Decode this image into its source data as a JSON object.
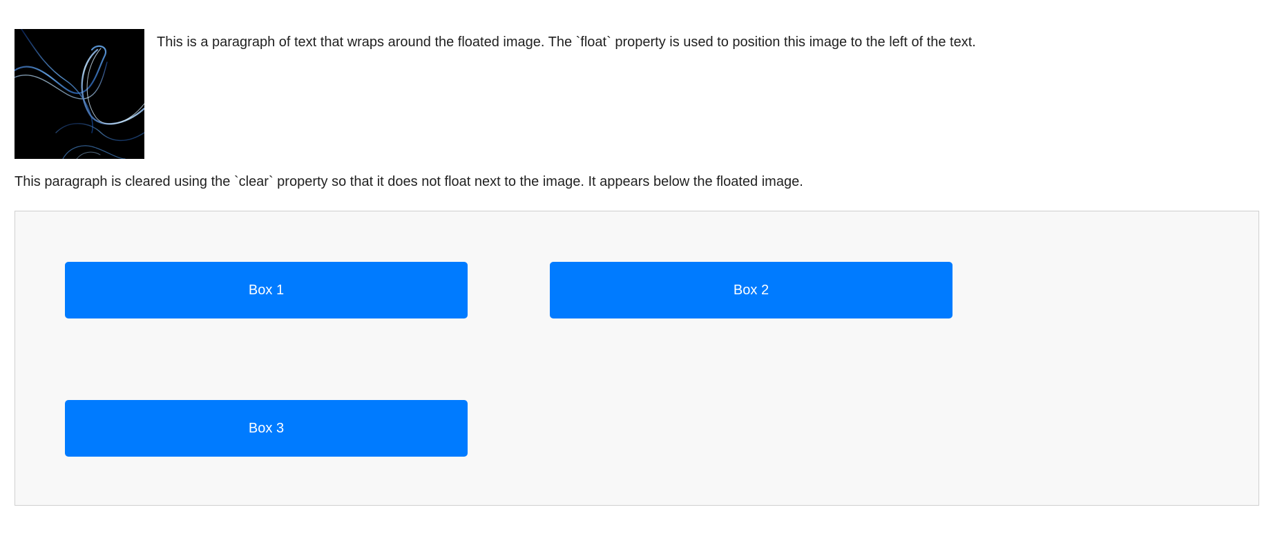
{
  "float_section": {
    "image_icon": "abstract-blue-smoke-image",
    "paragraph": "This is a paragraph of text that wraps around the floated image. The `float` property is used to position this image to the left of the text."
  },
  "clear_section": {
    "paragraph": "This paragraph is cleared using the `clear` property so that it does not float next to the image. It appears below the floated image."
  },
  "boxes": {
    "background_color": "#007bff",
    "container_color": "#f8f8f8",
    "items": [
      {
        "label": "Box 1"
      },
      {
        "label": "Box 2"
      },
      {
        "label": "Box 3"
      }
    ]
  }
}
